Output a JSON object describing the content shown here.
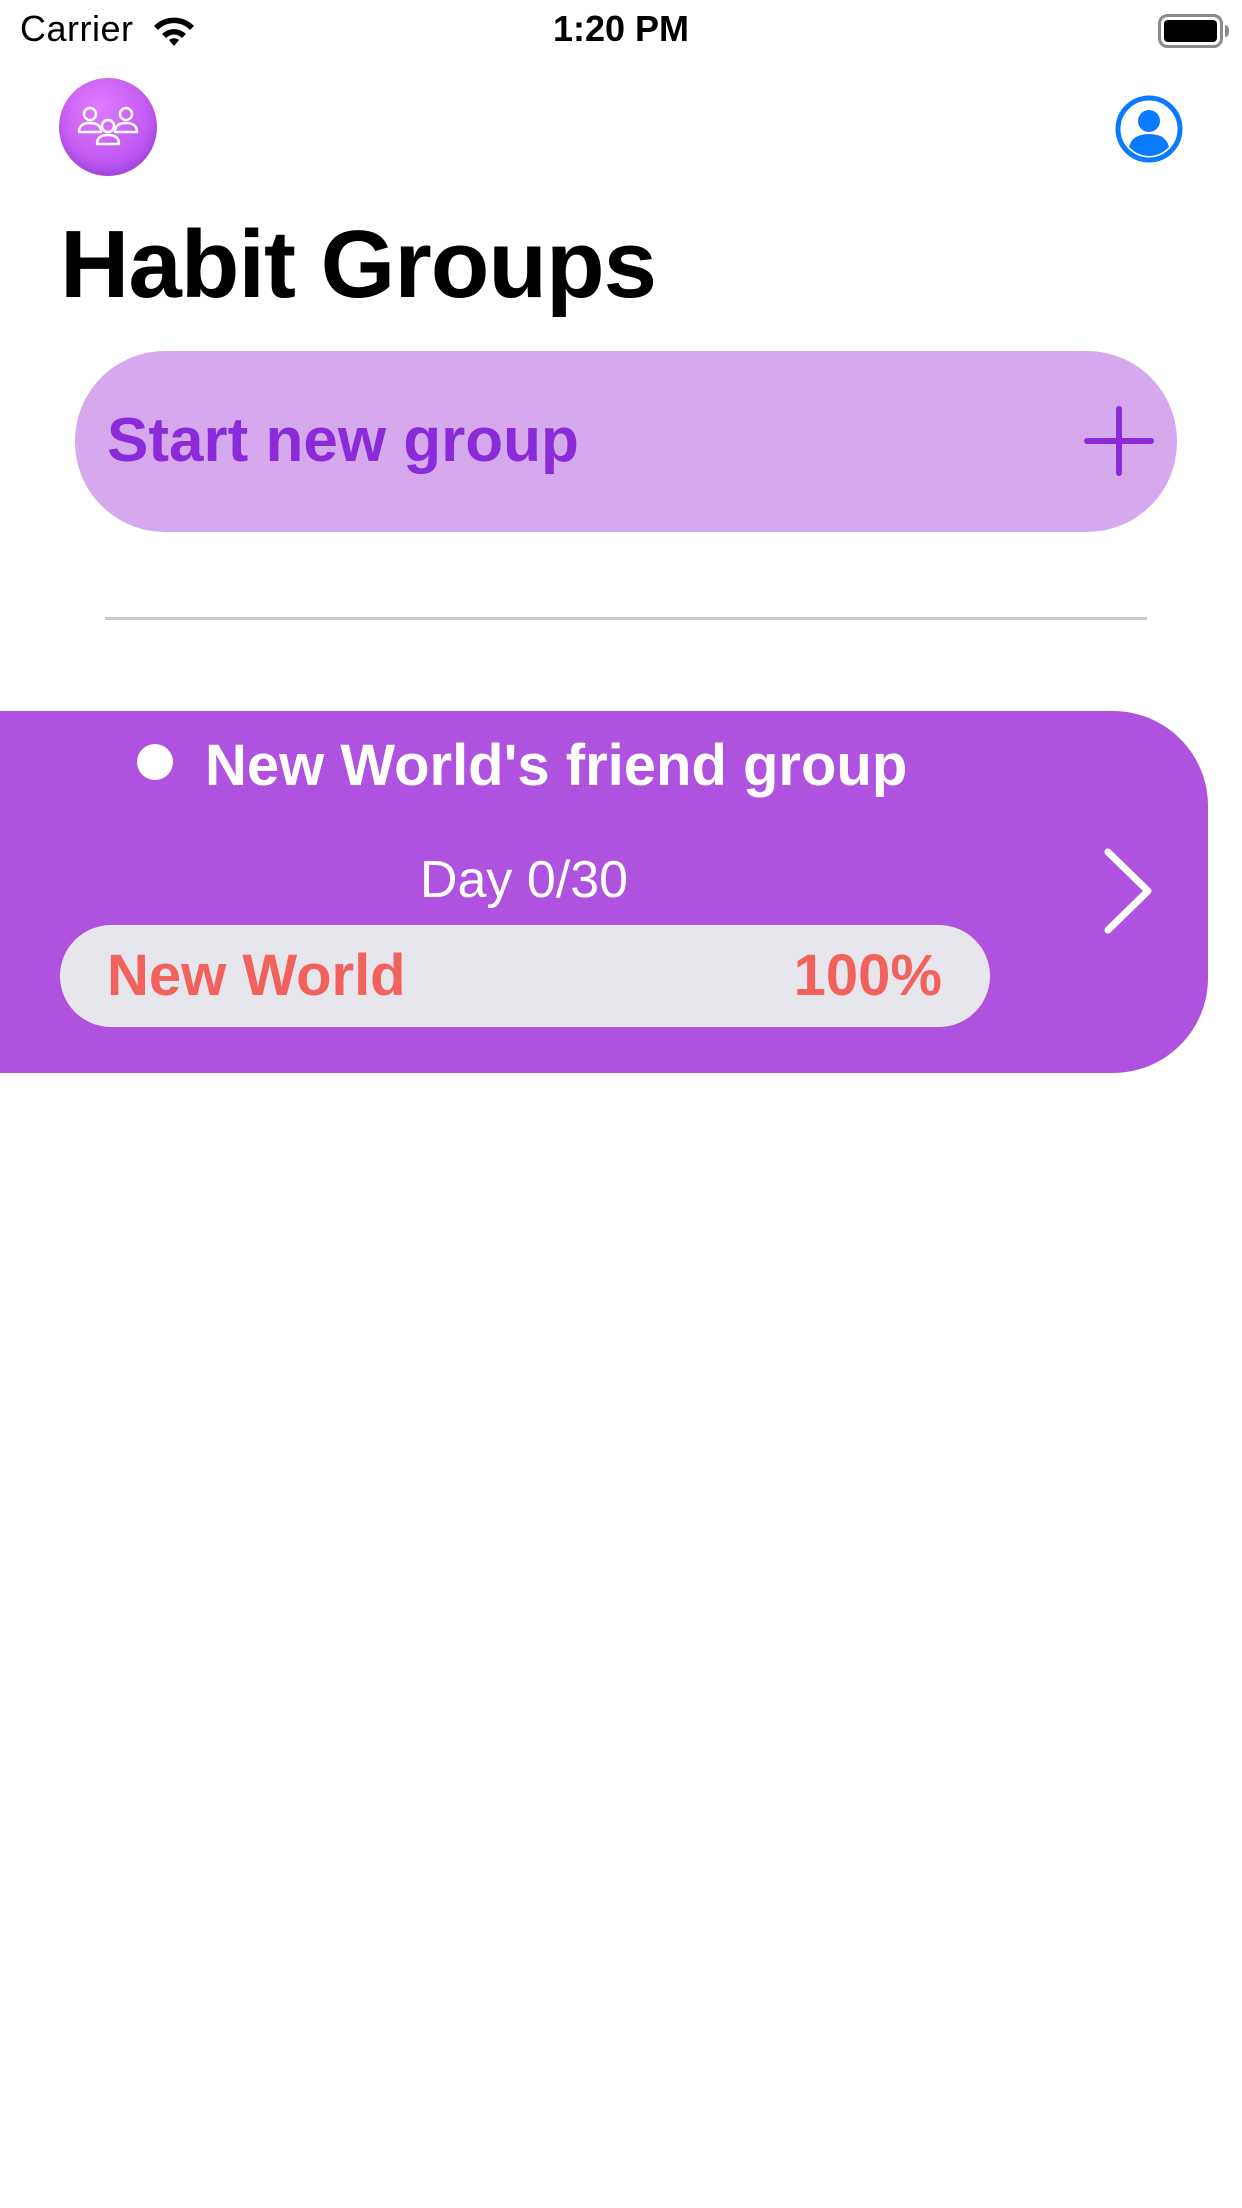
{
  "status_bar": {
    "carrier": "Carrier",
    "time": "1:20 PM",
    "wifi_icon": "wifi-icon",
    "battery_icon": "battery-full-icon"
  },
  "header": {
    "logo_icon": "group-people-icon",
    "profile_icon": "person-circle-icon",
    "title": "Habit Groups"
  },
  "start_group": {
    "label": "Start new group",
    "icon": "plus-icon"
  },
  "groups": [
    {
      "name": "New World's friend group",
      "day_label": "Day 0/30",
      "members": [
        {
          "name": "New World",
          "percent_label": "100%",
          "progress": 1.0
        }
      ],
      "chevron_icon": "chevron-right-icon"
    }
  ],
  "colors": {
    "accent": "#ae52df",
    "start_button_bg": "#d6a9ef",
    "start_button_text": "#8a2ad8",
    "progress_pill_bg": "#e7e6ec",
    "member_text": "#f0625b",
    "profile_icon": "#0a7aff",
    "divider": "#c9c9cc"
  }
}
